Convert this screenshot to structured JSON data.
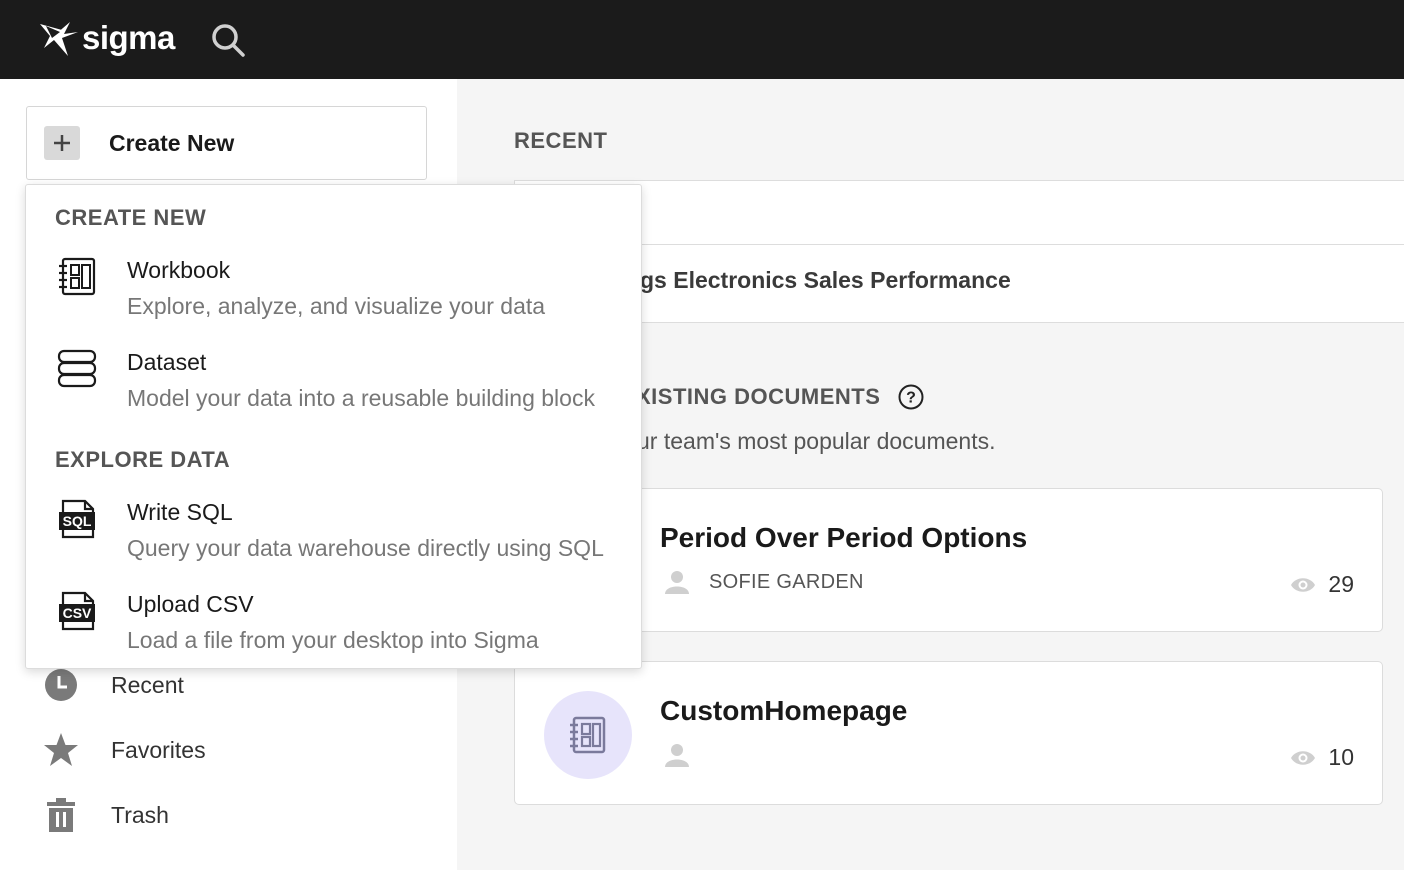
{
  "app": {
    "brand": "sigma",
    "icons": {
      "logo": "sigma-logo-icon",
      "search": "search-icon"
    }
  },
  "sidebar": {
    "create_new_label": "Create New",
    "items": [
      {
        "label": "Recent",
        "icon": "clock-icon"
      },
      {
        "label": "Favorites",
        "icon": "star-icon"
      },
      {
        "label": "Trash",
        "icon": "trash-icon"
      }
    ]
  },
  "create_menu": {
    "sections": [
      {
        "heading": "CREATE NEW",
        "items": [
          {
            "title": "Workbook",
            "description": "Explore, analyze, and visualize your data",
            "icon": "workbook-icon"
          },
          {
            "title": "Dataset",
            "description": "Model your data into a reusable building block",
            "icon": "dataset-icon"
          }
        ]
      },
      {
        "heading": "EXPLORE DATA",
        "items": [
          {
            "title": "Write SQL",
            "description": "Query your data warehouse directly using SQL",
            "icon": "sql-file-icon",
            "badge": "SQL"
          },
          {
            "title": "Upload CSV",
            "description": "Load a file from your desktop into Sigma",
            "icon": "csv-file-icon",
            "badge": "CSV"
          }
        ]
      }
    ]
  },
  "main": {
    "recent_heading": "RECENT",
    "recent_items": [
      {
        "title": "gs Electronics Sales Performance"
      }
    ],
    "existing_heading": "XISTING DOCUMENTS",
    "existing_subtitle": "ur team's most popular documents.",
    "documents": [
      {
        "title": "Period Over Period Options",
        "owner": "SOFIE GARDEN",
        "views": "29",
        "show_thumb": false
      },
      {
        "title": "CustomHomepage",
        "owner": "",
        "views": "10",
        "show_thumb": true
      }
    ]
  },
  "colors": {
    "topbar": "#1b1b1b",
    "thumb_bg": "#e7e4fb",
    "thumb_icon": "#7b7a9c",
    "muted_text": "#777777"
  }
}
